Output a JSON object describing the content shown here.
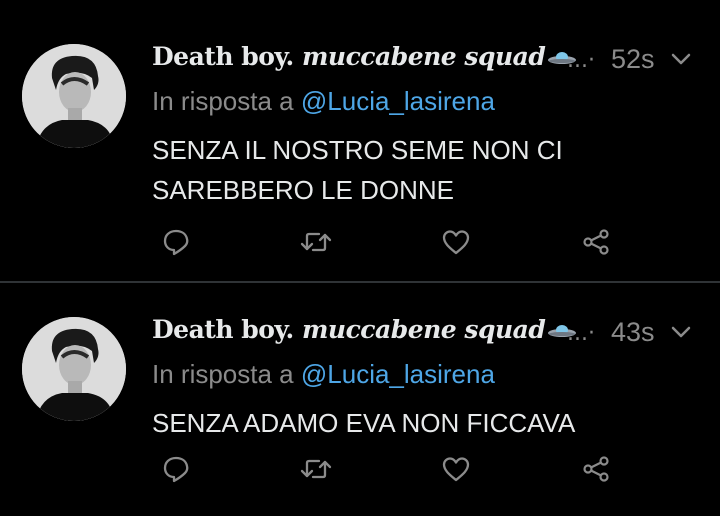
{
  "tweets": [
    {
      "author_name": "Death boy.",
      "author_squad": "muccabene squad",
      "ellipsis": "...·",
      "time": "52s",
      "reply_prefix": "In risposta a",
      "reply_mention": "@Lucia_lasirena",
      "text": "SENZA IL NOSTRO SEME NON CI SAREBBERO LE DONNE"
    },
    {
      "author_name": "Death boy.",
      "author_squad": "muccabene squad",
      "ellipsis": "...·",
      "time": "43s",
      "reply_prefix": "In risposta a",
      "reply_mention": "@Lucia_lasirena",
      "text": "SENZA ADAMO EVA NON FICCAVA"
    }
  ],
  "icons": {
    "reply": "reply-icon",
    "retweet": "retweet-icon",
    "like": "heart-icon",
    "share": "share-icon",
    "menu": "chevron-down-icon",
    "emoji": "ufo-emoji-icon"
  },
  "colors": {
    "background": "#000000",
    "text": "#e7e9ea",
    "muted": "#8b8b8b",
    "mention": "#4ea6e6",
    "divider": "#2f3336"
  }
}
